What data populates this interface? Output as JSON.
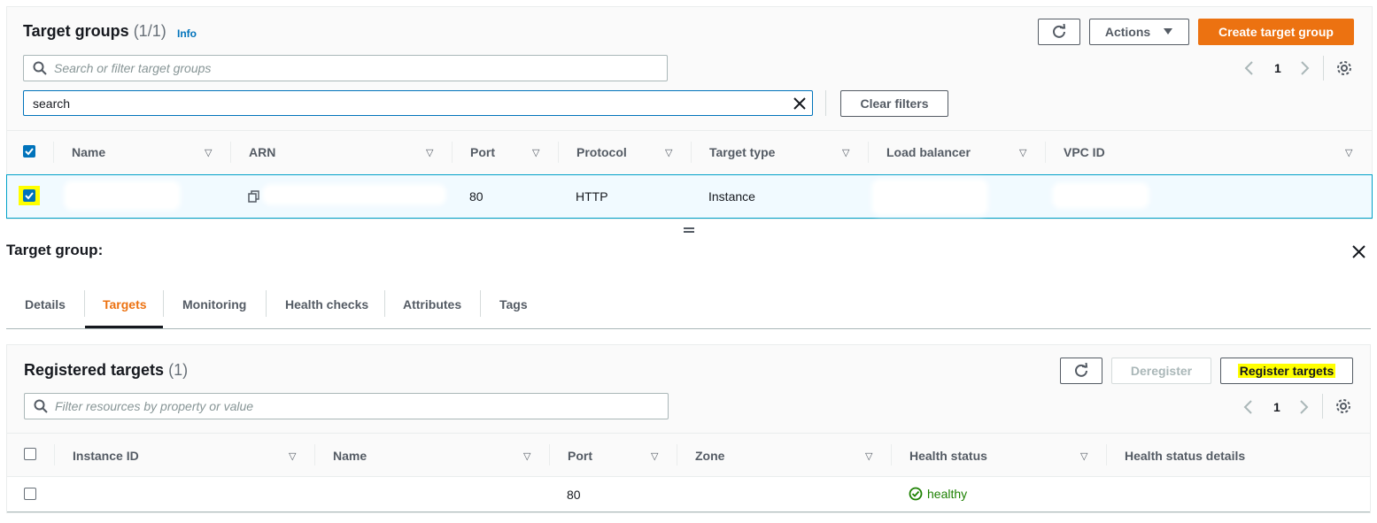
{
  "target_groups": {
    "title": "Target groups",
    "count": "(1/1)",
    "info_link": "Info",
    "search_placeholder": "Search or filter target groups",
    "filter_token": "search",
    "clear_filters": "Clear filters",
    "actions_label": "Actions",
    "create_label": "Create target group",
    "page": "1",
    "columns": [
      "Name",
      "ARN",
      "Port",
      "Protocol",
      "Target type",
      "Load balancer",
      "VPC ID"
    ],
    "row": {
      "port": "80",
      "protocol": "HTTP",
      "target_type": "Instance"
    }
  },
  "detail": {
    "title": "Target group:",
    "tabs": [
      "Details",
      "Targets",
      "Monitoring",
      "Health checks",
      "Attributes",
      "Tags"
    ],
    "active_tab": "Targets"
  },
  "registered": {
    "title": "Registered targets",
    "count": "(1)",
    "deregister_label": "Deregister",
    "register_label": "Register targets",
    "filter_placeholder": "Filter resources by property or value",
    "page": "1",
    "columns": [
      "Instance ID",
      "Name",
      "Port",
      "Zone",
      "Health status",
      "Health status details"
    ],
    "row": {
      "port": "80",
      "health": "healthy"
    }
  },
  "colors": {
    "accent": "#ec7211",
    "link": "#0073bb",
    "healthy": "#1d8102",
    "highlight": "#ffff00"
  }
}
